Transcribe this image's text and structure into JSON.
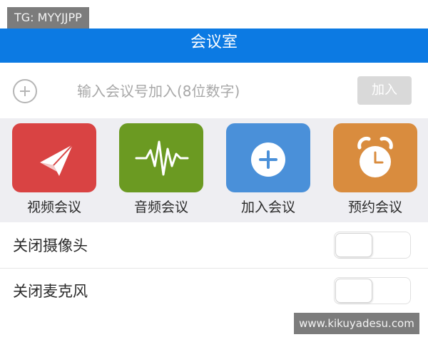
{
  "watermarks": {
    "top": "TG: MYYJJPP",
    "bottom": "www.kikuyadesu.com"
  },
  "header": {
    "title": "会议室"
  },
  "join": {
    "placeholder": "输入会议号加入(8位数字)",
    "value": "",
    "button_label": "加入",
    "icon": "plus-circle-icon"
  },
  "actions": [
    {
      "label": "视频会议",
      "icon": "paper-plane-icon",
      "color": "#d94343"
    },
    {
      "label": "音频会议",
      "icon": "audio-wave-icon",
      "color": "#6b9a22"
    },
    {
      "label": "加入会议",
      "icon": "plus-circle-icon",
      "color": "#4a90d9"
    },
    {
      "label": "预约会议",
      "icon": "alarm-clock-icon",
      "color": "#d98c3e"
    }
  ],
  "settings": [
    {
      "label": "关闭摄像头",
      "enabled": false
    },
    {
      "label": "关闭麦克风",
      "enabled": false
    }
  ],
  "colors": {
    "header_bg": "#0c7ae3",
    "actions_bg": "#eeeef2",
    "join_button_bg": "#d9d9d9"
  }
}
